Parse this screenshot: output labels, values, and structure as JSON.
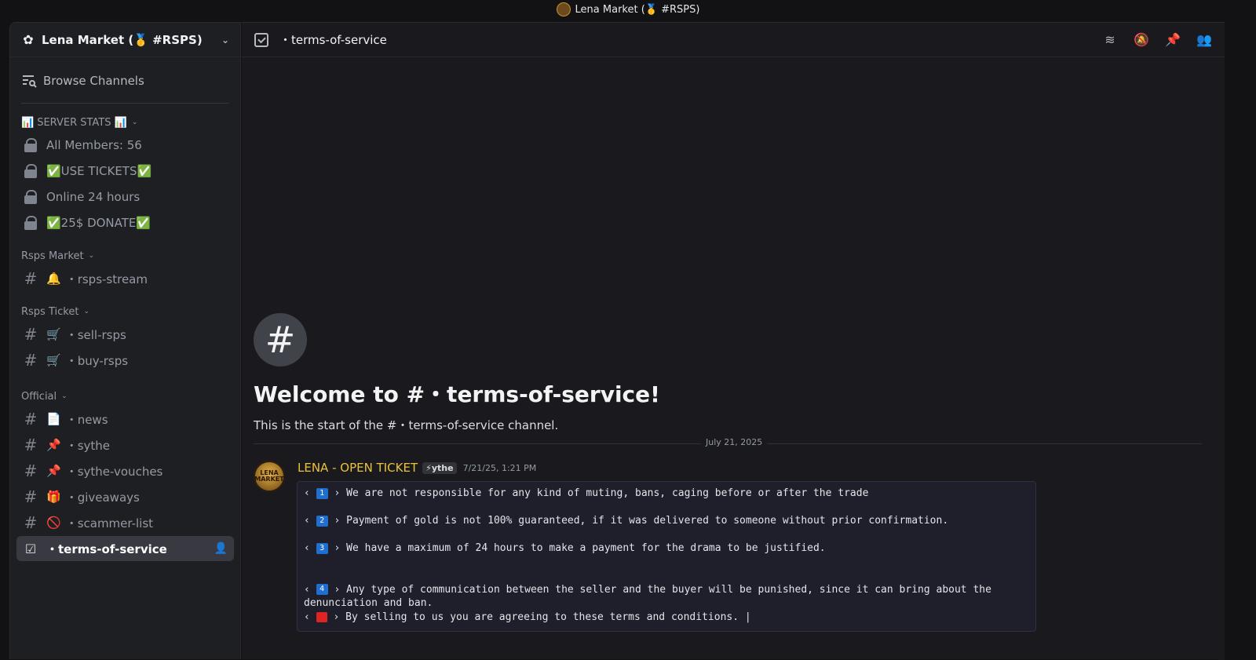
{
  "window": {
    "title": "Lena Market (🥇 #RSPS)"
  },
  "server": {
    "name": "Lena Market (🥇 #RSPS)"
  },
  "sidebar": {
    "browse_label": "Browse Channels",
    "categories": [
      {
        "label": "SERVER STATS 📊",
        "prefix": "📊"
      },
      {
        "label": "Rsps Market"
      },
      {
        "label": "Rsps Ticket"
      },
      {
        "label": "Official"
      }
    ],
    "stats": [
      "All Members: 56",
      "✅USE TICKETS✅",
      "Online 24 hours",
      "✅25$ DONATE✅"
    ],
    "market": [
      {
        "emoji": "🔔",
        "label": "・rsps-stream"
      }
    ],
    "ticket": [
      {
        "emoji": "🛒",
        "label": "・sell-rsps"
      },
      {
        "emoji": "🛒",
        "label": "・buy-rsps"
      }
    ],
    "official": [
      {
        "emoji": "📄",
        "label": "・news"
      },
      {
        "emoji": "📌",
        "label": "・sythe"
      },
      {
        "emoji": "📌",
        "label": "・sythe-vouches"
      },
      {
        "emoji": "🎁",
        "label": "・giveaways"
      },
      {
        "emoji": "🚫",
        "label": "・scammer-list"
      }
    ],
    "active": {
      "label": "・terms-of-service"
    }
  },
  "header": {
    "channel": "・terms-of-service"
  },
  "welcome": {
    "title": "Welcome to #・terms-of-service!",
    "subtitle": "This is the start of the #・terms-of-service channel."
  },
  "date_divider": "July 21, 2025",
  "message": {
    "author": "LENA - OPEN TICKET",
    "avatar_text": "LENA MARKET",
    "tag": "⚡ythe",
    "timestamp": "7/21/25, 1:21 PM",
    "lines": [
      {
        "num": "1",
        "text": "We are not responsible for any kind of muting, bans, caging before or after the trade"
      },
      {
        "num": "2",
        "text": "Payment of gold is not 100% guaranteed, if it was delivered to someone without prior confirmation."
      },
      {
        "num": "3",
        "text": "We have a maximum of 24 hours to make a payment for the drama to be justified."
      },
      {
        "num": "4",
        "text": "Any type of communication between the seller and the buyer will be punished, since it can bring about the denunciation and ban."
      },
      {
        "num": "",
        "text": "By selling to us you are agreeing to these terms and conditions. |"
      }
    ]
  },
  "colors": {
    "accent": "#e9c23c",
    "bg": "#1a1a1e",
    "sidebar": "#1e1f22"
  }
}
